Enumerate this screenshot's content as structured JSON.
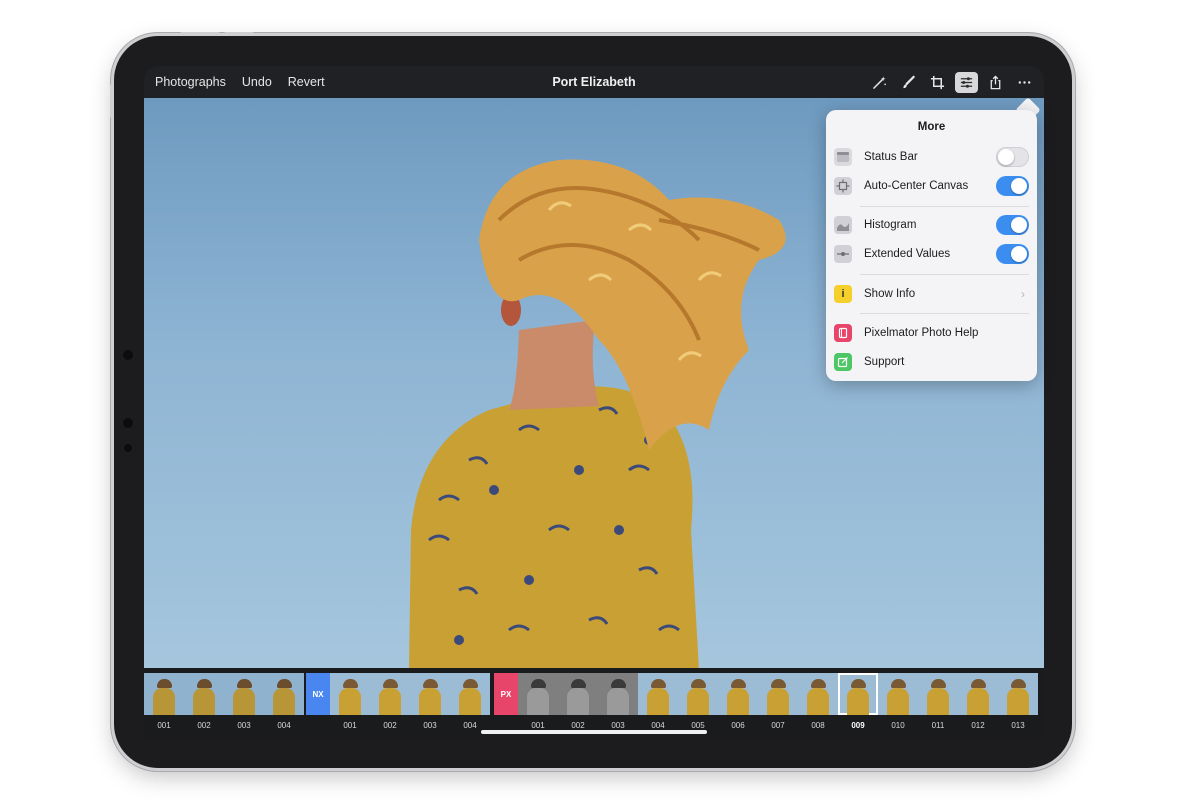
{
  "toolbar": {
    "back_label": "Photographs",
    "undo_label": "Undo",
    "revert_label": "Revert",
    "title": "Port Elizabeth",
    "icons": [
      "magic-wand-icon",
      "brush-icon",
      "crop-icon",
      "adjustments-icon",
      "share-icon",
      "more-icon"
    ],
    "active_icon": "adjustments-icon"
  },
  "more_menu": {
    "title": "More",
    "items": [
      {
        "label": "Status Bar",
        "icon": "status-bar-icon",
        "control": "toggle",
        "on": false
      },
      {
        "label": "Auto-Center Canvas",
        "icon": "auto-center-icon",
        "control": "toggle",
        "on": true
      },
      {
        "label": "Histogram",
        "icon": "histogram-icon",
        "control": "toggle",
        "on": true
      },
      {
        "label": "Extended Values",
        "icon": "extended-values-icon",
        "control": "toggle",
        "on": true
      },
      {
        "label": "Show Info",
        "icon": "info-icon",
        "icon_glyph": "i",
        "control": "chevron",
        "chevron": "›"
      },
      {
        "label": "Pixelmator Photo Help",
        "icon": "help-book-icon",
        "control": "none"
      },
      {
        "label": "Support",
        "icon": "support-icon",
        "control": "none"
      }
    ]
  },
  "filmstrip": {
    "groups": [
      {
        "badge": "",
        "labels": [
          "001",
          "002",
          "003",
          "004"
        ]
      },
      {
        "badge": "NX",
        "badge_color": "#4a86f0",
        "labels": [
          "001",
          "002",
          "003",
          "004"
        ]
      },
      {
        "badge": "PX",
        "badge_color": "#e8456a",
        "labels": [
          "001",
          "002",
          "003",
          "004",
          "005",
          "006",
          "007",
          "008",
          "009",
          "010",
          "011",
          "012",
          "013"
        ]
      }
    ],
    "selected": "009"
  },
  "colors": {
    "accent_toggle": "#3b8ef0",
    "sky": "#8fb5d4",
    "dress": "#c9a033",
    "hair": "#d9a24a"
  }
}
